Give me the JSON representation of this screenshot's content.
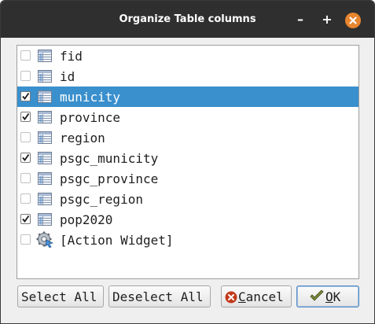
{
  "window": {
    "title": "Organize Table columns",
    "minimize_glyph": "–",
    "maximize_glyph": "+",
    "close_icon": "close-icon"
  },
  "columns": [
    {
      "label": "fid",
      "checked": false,
      "selected": false,
      "icon": "table-column-icon"
    },
    {
      "label": "id",
      "checked": false,
      "selected": false,
      "icon": "table-column-icon"
    },
    {
      "label": "municity",
      "checked": true,
      "selected": true,
      "icon": "table-column-icon"
    },
    {
      "label": "province",
      "checked": true,
      "selected": false,
      "icon": "table-column-icon"
    },
    {
      "label": "region",
      "checked": false,
      "selected": false,
      "icon": "table-column-icon"
    },
    {
      "label": "psgc_municity",
      "checked": true,
      "selected": false,
      "icon": "table-column-icon"
    },
    {
      "label": "psgc_province",
      "checked": false,
      "selected": false,
      "icon": "table-column-icon"
    },
    {
      "label": "psgc_region",
      "checked": false,
      "selected": false,
      "icon": "table-column-icon"
    },
    {
      "label": "pop2020",
      "checked": true,
      "selected": false,
      "icon": "table-column-icon"
    },
    {
      "label": "[Action Widget]",
      "checked": false,
      "selected": false,
      "icon": "action-widget-icon"
    }
  ],
  "buttons": {
    "select_all": "Select All",
    "deselect_all": "Deselect All",
    "cancel": "Cancel",
    "ok": "OK"
  },
  "colors": {
    "titlebar": "#2f2f2f",
    "close_button": "#e8852f",
    "selection": "#3a8fcd"
  }
}
